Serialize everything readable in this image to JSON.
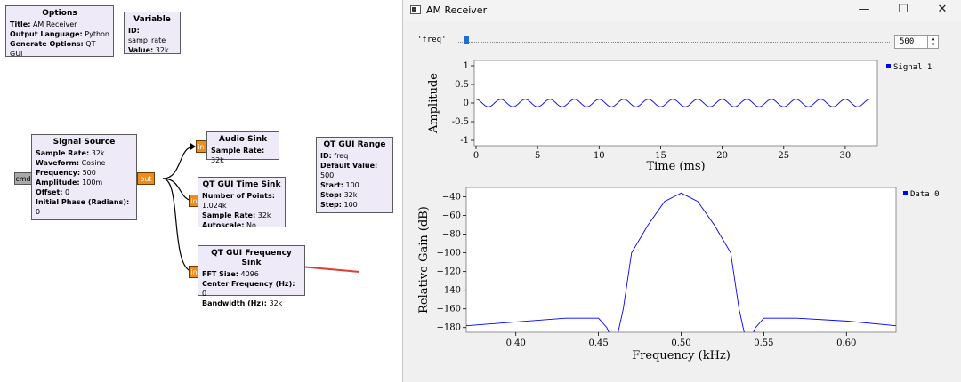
{
  "grc": {
    "options": {
      "title": "Options",
      "rows": [
        {
          "k": "Title:",
          "v": "AM Receiver"
        },
        {
          "k": "Output Language:",
          "v": "Python"
        },
        {
          "k": "Generate Options:",
          "v": "QT GUI"
        }
      ]
    },
    "variable": {
      "title": "Variable",
      "rows": [
        {
          "k": "ID:",
          "v": "samp_rate"
        },
        {
          "k": "Value:",
          "v": "32k"
        }
      ]
    },
    "signal_source": {
      "title": "Signal Source",
      "rows": [
        {
          "k": "Sample Rate:",
          "v": "32k"
        },
        {
          "k": "Waveform:",
          "v": "Cosine"
        },
        {
          "k": "Frequency:",
          "v": "500"
        },
        {
          "k": "Amplitude:",
          "v": "100m"
        },
        {
          "k": "Offset:",
          "v": "0"
        },
        {
          "k": "Initial Phase (Radians):",
          "v": "0"
        }
      ],
      "port_out": "out",
      "port_cmd": "cmd"
    },
    "audio_sink": {
      "title": "Audio Sink",
      "rows": [
        {
          "k": "Sample Rate:",
          "v": "32k"
        }
      ],
      "port_in": "in"
    },
    "time_sink": {
      "title": "QT GUI Time Sink",
      "rows": [
        {
          "k": "Number of Points:",
          "v": "1.024k"
        },
        {
          "k": "Sample Rate:",
          "v": "32k"
        },
        {
          "k": "Autoscale:",
          "v": "No"
        }
      ],
      "port_in": "in"
    },
    "freq_sink": {
      "title": "QT GUI Frequency Sink",
      "rows": [
        {
          "k": "FFT Size:",
          "v": "4096"
        },
        {
          "k": "Center Frequency (Hz):",
          "v": "0"
        },
        {
          "k": "Bandwidth (Hz):",
          "v": "32k"
        }
      ],
      "port_in": "in"
    },
    "range": {
      "title": "QT GUI Range",
      "rows": [
        {
          "k": "ID:",
          "v": "freq"
        },
        {
          "k": "Default Value:",
          "v": "500"
        },
        {
          "k": "Start:",
          "v": "100"
        },
        {
          "k": "Stop:",
          "v": "32k"
        },
        {
          "k": "Step:",
          "v": "100"
        }
      ]
    }
  },
  "window": {
    "title": "AM Receiver",
    "controls": {
      "minimize": "—",
      "maximize": "☐",
      "close": "✕"
    },
    "slider": {
      "label": "'freq'",
      "value": "500",
      "min": 100,
      "max": 32000,
      "current": 500
    }
  },
  "colors": {
    "block_bg": "#eeeaf7",
    "port": "#f08c1b",
    "curve": "#0000ff",
    "arrow": "#e53935"
  },
  "chart_data": [
    {
      "type": "line",
      "xlabel": "Time (ms)",
      "ylabel": "Amplitude",
      "xticks": [
        "0",
        "5",
        "10",
        "15",
        "20",
        "25",
        "30"
      ],
      "yticks": [
        "1",
        "0.5",
        "0",
        "-0.5",
        "-1"
      ],
      "xlim": [
        0,
        32
      ],
      "ylim": [
        -1,
        1
      ],
      "series": [
        {
          "name": "Signal 1",
          "frequency_hz": 500,
          "amplitude": 0.1
        }
      ]
    },
    {
      "type": "line",
      "xlabel": "Frequency (kHz)",
      "ylabel": "Relative Gain (dB)",
      "xticks": [
        "0.40",
        "0.45",
        "0.50",
        "0.55",
        "0.60"
      ],
      "yticks": [
        "-40",
        "-60",
        "-80",
        "-100",
        "-120",
        "-140",
        "-160",
        "-180"
      ],
      "xlim": [
        0.37,
        0.63
      ],
      "ylim": [
        -185,
        -30
      ],
      "series": [
        {
          "name": "Data 0",
          "x": [
            0.37,
            0.4,
            0.43,
            0.45,
            0.455,
            0.46,
            0.465,
            0.47,
            0.48,
            0.49,
            0.5,
            0.51,
            0.52,
            0.53,
            0.535,
            0.54,
            0.545,
            0.55,
            0.57,
            0.6,
            0.63
          ],
          "y": [
            -178,
            -174,
            -170,
            -170,
            -180,
            -200,
            -160,
            -100,
            -70,
            -45,
            -36,
            -45,
            -70,
            -100,
            -160,
            -200,
            -180,
            -170,
            -170,
            -173,
            -178
          ]
        }
      ]
    }
  ]
}
